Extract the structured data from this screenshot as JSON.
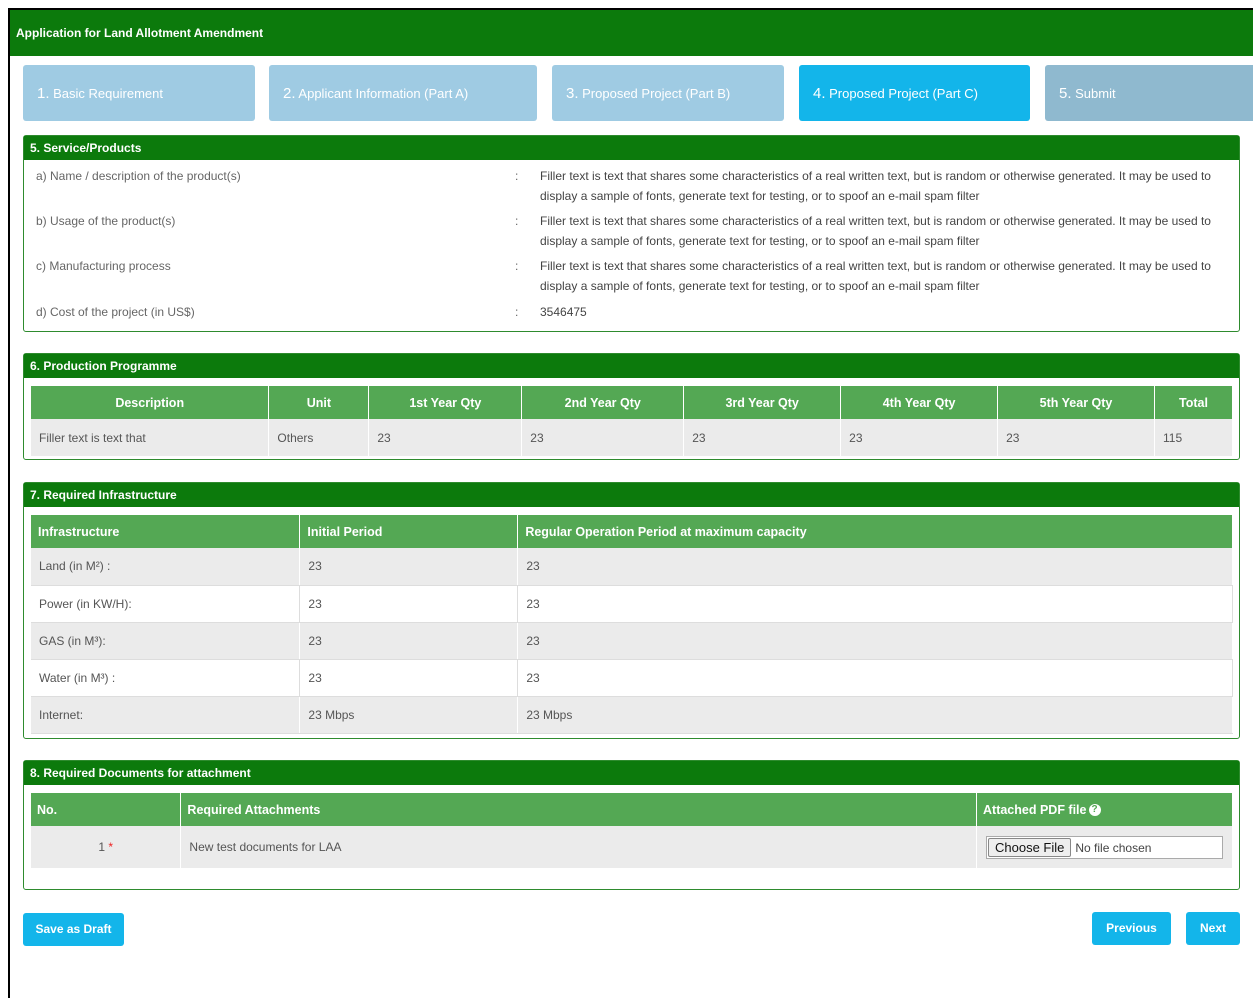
{
  "app": {
    "title": "Application for Land Allotment Amendment"
  },
  "steps": [
    {
      "num": "1.",
      "label": "Basic Requirement"
    },
    {
      "num": "2.",
      "label": "Applicant Information (Part A)"
    },
    {
      "num": "3.",
      "label": "Proposed Project (Part B)"
    },
    {
      "num": "4.",
      "label": "Proposed Project (Part C)"
    },
    {
      "num": "5.",
      "label": "Submit"
    }
  ],
  "active_step": 4,
  "colors": {
    "header": "#0c7a0c",
    "table_header": "#54a854",
    "active_step": "#13b5ea",
    "inactive_step": "#9fcbe3"
  },
  "service": {
    "title": "5. Service/Products",
    "rows": [
      {
        "label": "a) Name / description of the product(s)",
        "value": "Filler text is text that shares some characteristics of a real written text, but is random or otherwise generated. It may be used to display a sample of fonts, generate text for testing, or to spoof an e-mail spam filter"
      },
      {
        "label": "b) Usage of the product(s)",
        "value": "Filler text is text that shares some characteristics of a real written text, but is random or otherwise generated. It may be used to display a sample of fonts, generate text for testing, or to spoof an e-mail spam filter"
      },
      {
        "label": "c) Manufacturing process",
        "value": "Filler text is text that shares some characteristics of a real written text, but is random or otherwise generated. It may be used to display a sample of fonts, generate text for testing, or to spoof an e-mail spam filter"
      },
      {
        "label": "d) Cost of the project (in US$)",
        "value": "3546475"
      }
    ],
    "colon": ":"
  },
  "production": {
    "title": "6. Production Programme",
    "headers": [
      "Description",
      "Unit",
      "1st Year Qty",
      "2nd Year Qty",
      "3rd Year Qty",
      "4th Year Qty",
      "5th Year Qty",
      "Total"
    ],
    "row": [
      "Filler text is text that",
      "Others",
      "23",
      "23",
      "23",
      "23",
      "23",
      "115"
    ]
  },
  "infrastructure": {
    "title": "7. Required Infrastructure",
    "headers": [
      "Infrastructure",
      "Initial Period",
      "Regular Operation Period at maximum capacity"
    ],
    "rows": [
      [
        "Land (in M²) :",
        "23",
        "23"
      ],
      [
        "Power (in KW/H):",
        "23",
        "23"
      ],
      [
        "GAS (in M³):",
        "23",
        "23"
      ],
      [
        "Water (in M³) :",
        "23",
        "23"
      ],
      [
        "Internet:",
        "23 Mbps",
        "23 Mbps"
      ]
    ]
  },
  "documents": {
    "title": "8. Required Documents for attachment",
    "headers": [
      "No.",
      "Required Attachments",
      "Attached PDF file"
    ],
    "row": {
      "no": "1",
      "star": "*",
      "name": "New test documents for LAA",
      "file_button": "Choose File",
      "file_status": "No file chosen"
    }
  },
  "buttons": {
    "save_draft": "Save as Draft",
    "previous": "Previous",
    "next": "Next"
  }
}
